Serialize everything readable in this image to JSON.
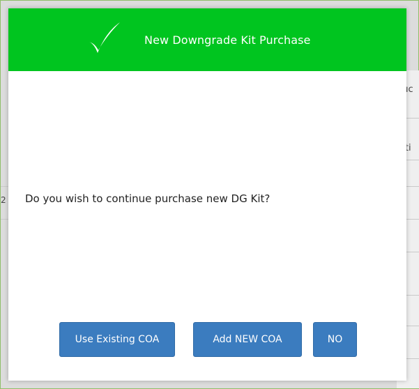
{
  "dialog": {
    "title": "New Downgrade Kit Purchase",
    "message": "Do you wish to continue purchase new DG Kit?",
    "header_color": "#00c51f",
    "icon": "checkmark-icon"
  },
  "buttons": {
    "use_existing": "Use Existing COA",
    "add_new": "Add NEW COA",
    "no": "NO",
    "color": "#3b7cbf"
  },
  "background": {
    "right_fragments": [
      "duc",
      "diti"
    ],
    "left_fragment": "2"
  }
}
